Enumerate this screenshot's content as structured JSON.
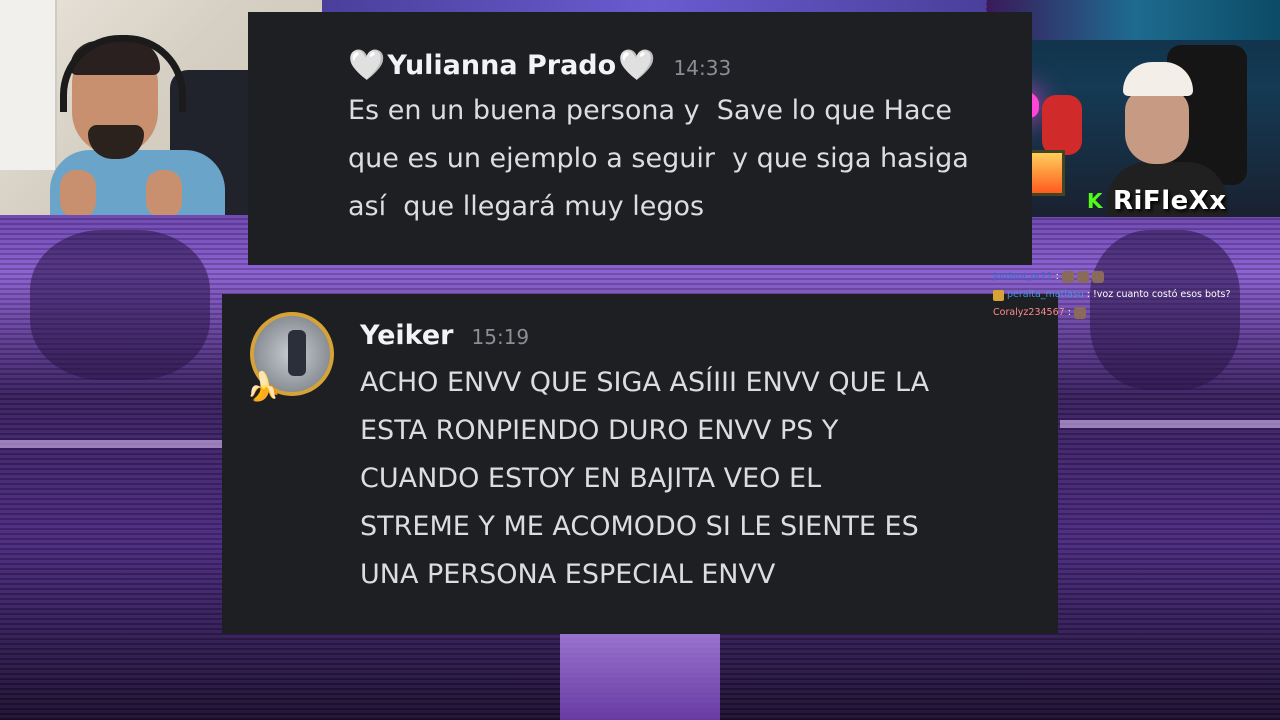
{
  "streamer": {
    "name": "RiFleXx",
    "platform_icon": "kick-icon"
  },
  "overlay_letter": "R",
  "messages": [
    {
      "author": "Yulianna Prado",
      "author_decoration": "🤍",
      "time": "14:33",
      "body": "Es en un buena persona y  Save lo que Hace\nque es un ejemplo a seguir  y que siga hasiga\nasí  que llegará muy legos"
    },
    {
      "author": "Yeiker",
      "time": "15:19",
      "body": "ACHO ENVV QUE SIGA ASÍIII ENVV QUE LA\nESTA RONPIENDO DURO ENVV PS Y\nCUANDO ESTOY EN BAJITA VEO EL\nSTREME Y ME ACOMODO SI LE SIENTE ES\nUNA PERSONA ESPECIAL ENVV"
    }
  ],
  "live_chat": [
    {
      "user": "Jordani_pr11",
      "text": ""
    },
    {
      "user": "peralta_matiasu",
      "text": "!voz cuanto costó esos bots?"
    },
    {
      "user": "Coralyz234567",
      "text": ""
    }
  ],
  "colors": {
    "card_bg": "#1e1f22",
    "accent_kick": "#53fc18",
    "avatar_ring": "#d7a336"
  }
}
